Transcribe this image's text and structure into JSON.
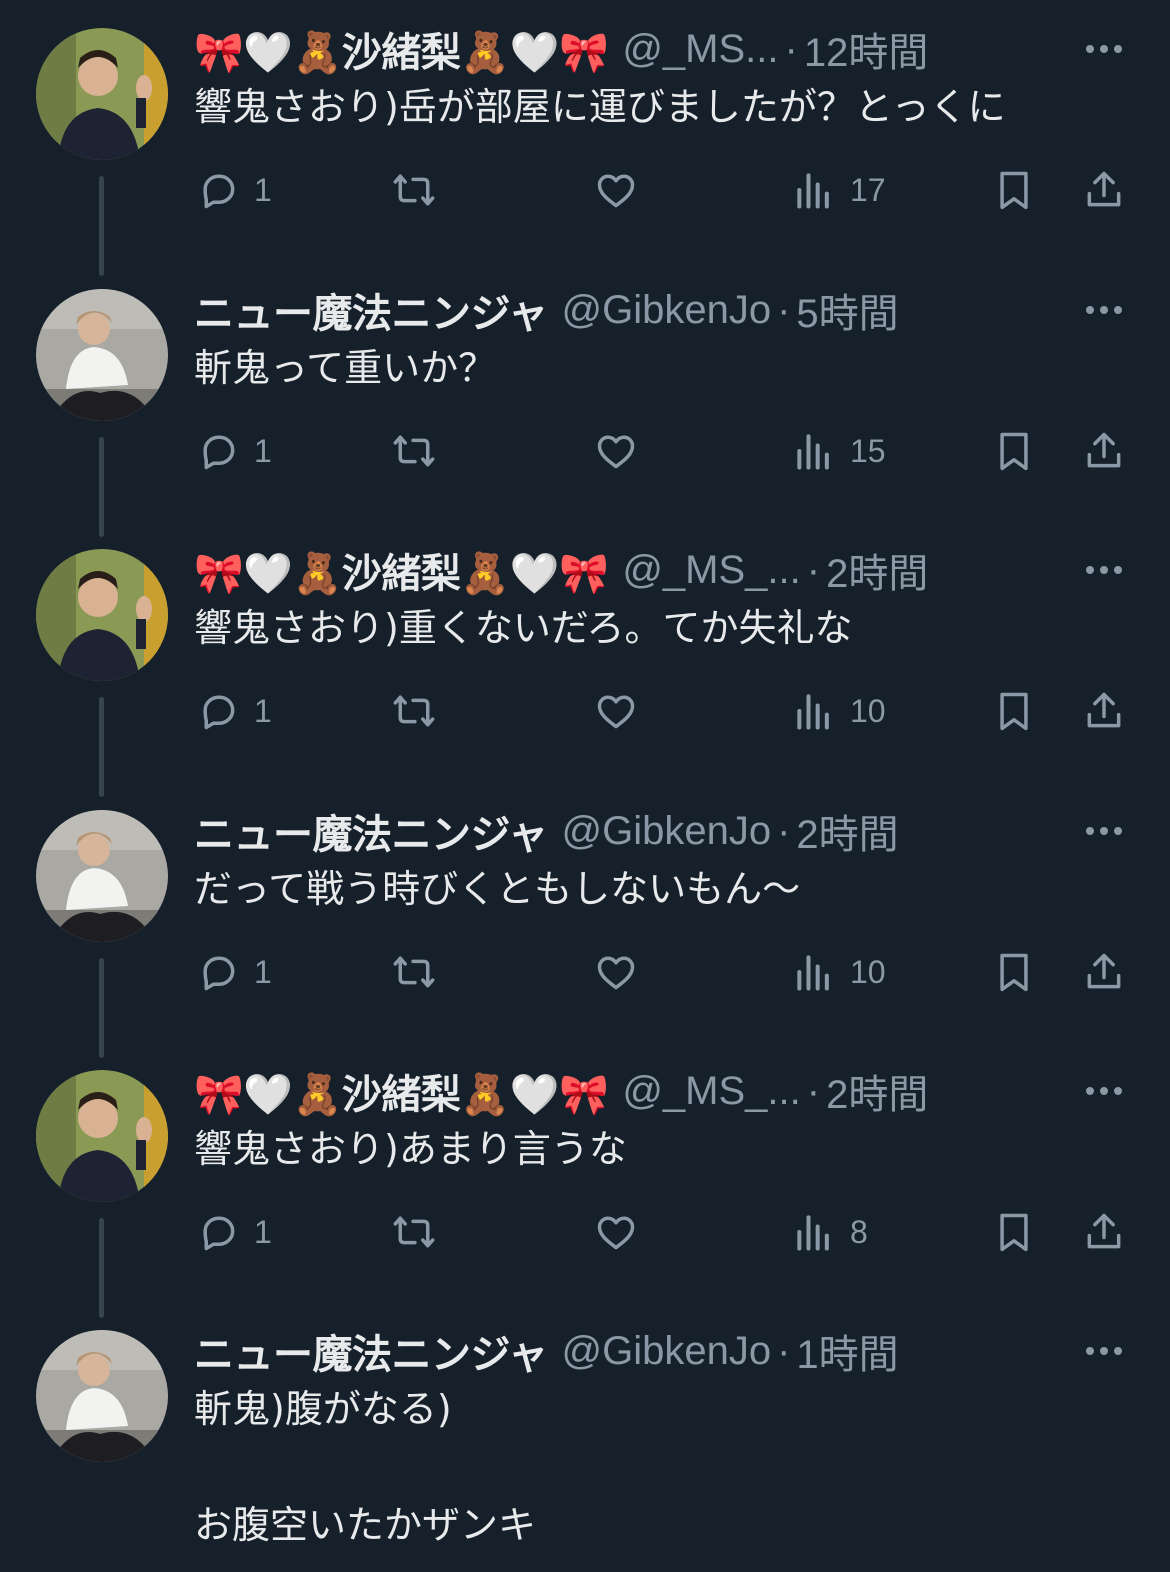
{
  "colors": {
    "background": "#15202b",
    "text": "#e7e9ea",
    "muted": "#8b98a5",
    "connector": "#38444d"
  },
  "tweets": [
    {
      "author": "🎀🤍🧸沙緒梨🧸🤍🎀",
      "handle": "@_MS...",
      "dot": "·",
      "time": "12時間",
      "text": "響鬼さおり)岳が部屋に運びましたが？とっくに",
      "replies": "1",
      "views": "17",
      "avatar": "man-waving-avatar"
    },
    {
      "author": "ニュー魔法ニンジャ",
      "handle": "@GibkenJo",
      "dot": "·",
      "time": "5時間",
      "text": "斬鬼って重いか？",
      "replies": "1",
      "views": "15",
      "avatar": "man-crouching-avatar"
    },
    {
      "author": "🎀🤍🧸沙緒梨🧸🤍🎀",
      "handle": "@_MS_...",
      "dot": "·",
      "time": "2時間",
      "text": "響鬼さおり)重くないだろ。てか失礼な",
      "replies": "1",
      "views": "10",
      "avatar": "man-waving-avatar"
    },
    {
      "author": "ニュー魔法ニンジャ",
      "handle": "@GibkenJo",
      "dot": "·",
      "time": "2時間",
      "text": "だって戦う時びくともしないもん〜",
      "replies": "1",
      "views": "10",
      "avatar": "man-crouching-avatar"
    },
    {
      "author": "🎀🤍🧸沙緒梨🧸🤍🎀",
      "handle": "@_MS_...",
      "dot": "·",
      "time": "2時間",
      "text": "響鬼さおり)あまり言うな",
      "replies": "1",
      "views": "8",
      "avatar": "man-waving-avatar"
    },
    {
      "author": "ニュー魔法ニンジャ",
      "handle": "@GibkenJo",
      "dot": "·",
      "time": "1時間",
      "text": "斬鬼)腹がなる)\n\nお腹空いたかザンキ",
      "avatar": "man-crouching-avatar"
    }
  ]
}
